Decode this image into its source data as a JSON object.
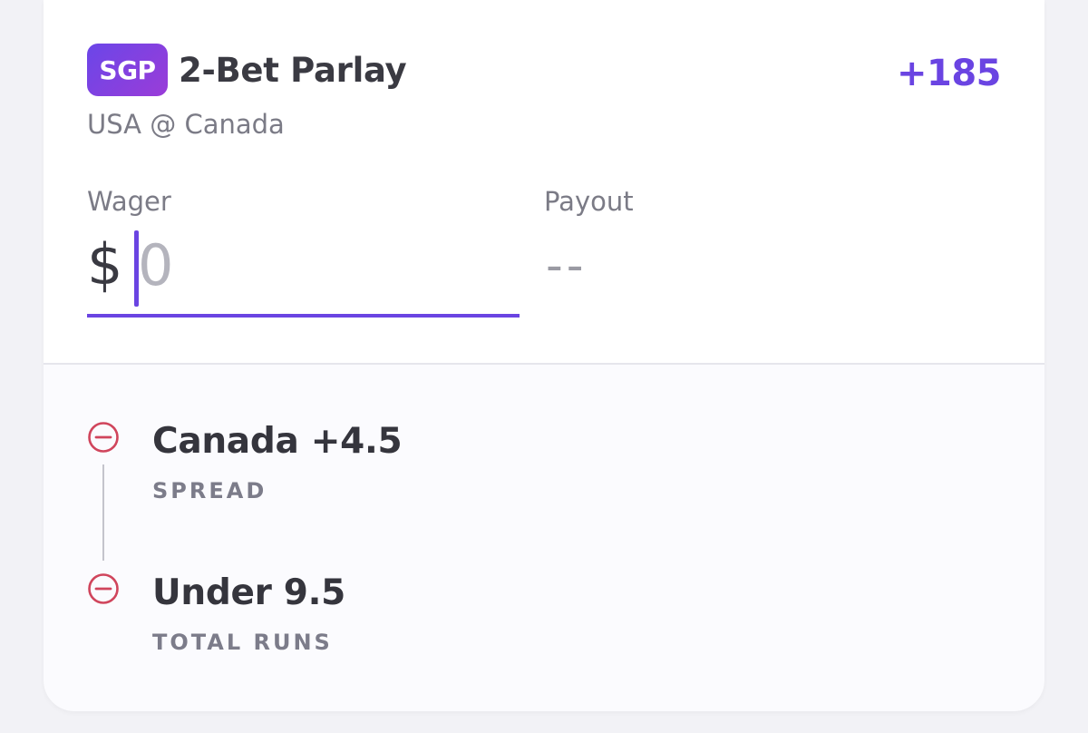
{
  "bet": {
    "badge": "SGP",
    "title": "2-Bet Parlay",
    "matchup": "USA @ Canada",
    "odds": "+185"
  },
  "wager": {
    "label": "Wager",
    "currency": "$",
    "placeholder": "0",
    "value": ""
  },
  "payout": {
    "label": "Payout",
    "value": "--"
  },
  "legs": [
    {
      "selection": "Canada +4.5",
      "market": "SPREAD",
      "icon": "remove-circle-icon"
    },
    {
      "selection": "Under 9.5",
      "market": "TOTAL RUNS",
      "icon": "remove-circle-icon"
    }
  ],
  "colors": {
    "accent": "#6a44e2",
    "badge_gradient_start": "#6b46e8",
    "badge_gradient_end": "#9a3cd8",
    "remove": "#d0455c"
  }
}
